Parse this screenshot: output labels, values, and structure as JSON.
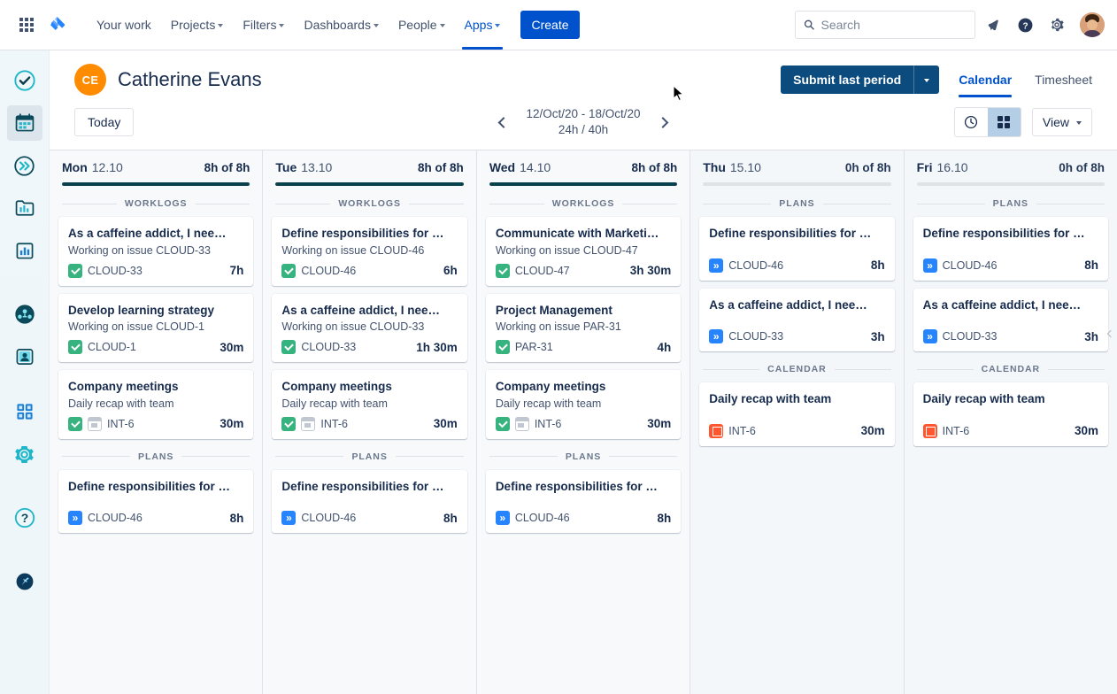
{
  "topnav": {
    "app_switcher_icon": "apps-grid-icon",
    "logo_icon": "jira-logo-icon",
    "items": [
      {
        "label": "Your work",
        "has_caret": false,
        "active": false
      },
      {
        "label": "Projects",
        "has_caret": true,
        "active": false
      },
      {
        "label": "Filters",
        "has_caret": true,
        "active": false
      },
      {
        "label": "Dashboards",
        "has_caret": true,
        "active": false
      },
      {
        "label": "People",
        "has_caret": true,
        "active": false
      },
      {
        "label": "Apps",
        "has_caret": true,
        "active": true
      }
    ],
    "create_label": "Create",
    "search": {
      "placeholder": "Search",
      "value": "",
      "icon": "search-icon"
    },
    "notifications_icon": "notifications-bell-icon",
    "help_icon": "help-circle-icon",
    "settings_icon": "gear-icon",
    "profile_icon": "profile-avatar"
  },
  "rail": {
    "items": [
      {
        "name": "tasks-check-icon",
        "selected": false
      },
      {
        "name": "calendar-icon",
        "selected": true
      },
      {
        "name": "epic-forward-icon",
        "selected": false
      },
      {
        "name": "reports-folder-icon",
        "selected": false
      },
      {
        "name": "analytics-chart-icon",
        "selected": false
      },
      {
        "name": "team-globe-icon",
        "selected": false
      },
      {
        "name": "person-card-icon",
        "selected": false
      },
      {
        "name": "apps-squares-icon",
        "selected": false
      },
      {
        "name": "settings-gear-icon",
        "selected": false
      },
      {
        "name": "help-question-icon",
        "selected": false
      },
      {
        "name": "pin-icon",
        "selected": false
      }
    ]
  },
  "header": {
    "avatar_initials": "CE",
    "avatar_color": "#ff8b00",
    "user_name": "Catherine Evans",
    "submit_label": "Submit last period",
    "submit_color": "#0c4b7e",
    "tabs": [
      {
        "label": "Calendar",
        "active": true
      },
      {
        "label": "Timesheet",
        "active": false
      }
    ]
  },
  "toolbar": {
    "today_label": "Today",
    "prev_icon": "chevron-left-icon",
    "next_icon": "chevron-right-icon",
    "range_dates": "12/Oct/20 - 18/Oct/20",
    "range_hours": "24h / 40h",
    "timeline_view_icon": "clock-icon",
    "grid_view_icon": "grid-icon",
    "grid_view_active": true,
    "view_label": "View"
  },
  "section_labels": {
    "worklogs": "WORKLOGS",
    "plans": "PLANS",
    "calendar": "CALENDAR"
  },
  "days": [
    {
      "dow": "Mon",
      "date": "12.10",
      "hours": "8h of 8h",
      "progress_pct": 100,
      "sections": [
        {
          "label": "WORKLOGS",
          "cards": [
            {
              "kind": "worklog",
              "title": "As a caffeine addict, I nee…",
              "subtitle": "Working on issue CLOUD-33",
              "icons": [
                "task"
              ],
              "key": "CLOUD-33",
              "duration": "7h"
            },
            {
              "kind": "worklog",
              "title": "Develop learning strategy",
              "subtitle": "Working on issue CLOUD-1",
              "icons": [
                "task"
              ],
              "key": "CLOUD-1",
              "duration": "30m"
            },
            {
              "kind": "worklog",
              "title": "Company meetings",
              "subtitle": "Daily recap with team",
              "icons": [
                "task",
                "cal-grey"
              ],
              "key": "INT-6",
              "duration": "30m"
            }
          ]
        },
        {
          "label": "PLANS",
          "cards": [
            {
              "kind": "plan",
              "title": "Define responsibilities for …",
              "subtitle": "",
              "icons": [
                "epic"
              ],
              "key": "CLOUD-46",
              "duration": "8h"
            }
          ]
        }
      ]
    },
    {
      "dow": "Tue",
      "date": "13.10",
      "hours": "8h of 8h",
      "progress_pct": 100,
      "sections": [
        {
          "label": "WORKLOGS",
          "cards": [
            {
              "kind": "worklog",
              "title": "Define responsibilities for …",
              "subtitle": "Working on issue CLOUD-46",
              "icons": [
                "task"
              ],
              "key": "CLOUD-46",
              "duration": "6h"
            },
            {
              "kind": "worklog",
              "title": "As a caffeine addict, I nee…",
              "subtitle": "Working on issue CLOUD-33",
              "icons": [
                "task"
              ],
              "key": "CLOUD-33",
              "duration": "1h 30m"
            },
            {
              "kind": "worklog",
              "title": "Company meetings",
              "subtitle": "Daily recap with team",
              "icons": [
                "task",
                "cal-grey"
              ],
              "key": "INT-6",
              "duration": "30m"
            }
          ]
        },
        {
          "label": "PLANS",
          "cards": [
            {
              "kind": "plan",
              "title": "Define responsibilities for …",
              "subtitle": "",
              "icons": [
                "epic"
              ],
              "key": "CLOUD-46",
              "duration": "8h"
            }
          ]
        }
      ]
    },
    {
      "dow": "Wed",
      "date": "14.10",
      "hours": "8h of 8h",
      "progress_pct": 100,
      "sections": [
        {
          "label": "WORKLOGS",
          "cards": [
            {
              "kind": "worklog",
              "title": "Communicate with Marketi…",
              "subtitle": "Working on issue CLOUD-47",
              "icons": [
                "task"
              ],
              "key": "CLOUD-47",
              "duration": "3h 30m"
            },
            {
              "kind": "worklog",
              "title": "Project Management",
              "subtitle": "Working on issue PAR-31",
              "icons": [
                "task"
              ],
              "key": "PAR-31",
              "duration": "4h"
            },
            {
              "kind": "worklog",
              "title": "Company meetings",
              "subtitle": "Daily recap with team",
              "icons": [
                "task",
                "cal-grey"
              ],
              "key": "INT-6",
              "duration": "30m"
            }
          ]
        },
        {
          "label": "PLANS",
          "cards": [
            {
              "kind": "plan",
              "title": "Define responsibilities for …",
              "subtitle": "",
              "icons": [
                "epic"
              ],
              "key": "CLOUD-46",
              "duration": "8h"
            }
          ]
        }
      ]
    },
    {
      "dow": "Thu",
      "date": "15.10",
      "hours": "0h of 8h",
      "progress_pct": 0,
      "sections": [
        {
          "label": "PLANS",
          "cards": [
            {
              "kind": "plan",
              "title": "Define responsibilities for …",
              "subtitle": "",
              "icons": [
                "epic"
              ],
              "key": "CLOUD-46",
              "duration": "8h"
            },
            {
              "kind": "plan",
              "title": "As a caffeine addict, I nee…",
              "subtitle": "",
              "icons": [
                "epic"
              ],
              "key": "CLOUD-33",
              "duration": "3h"
            }
          ]
        },
        {
          "label": "CALENDAR",
          "cards": [
            {
              "kind": "cal",
              "title": "Daily recap with team",
              "subtitle": "",
              "icons": [
                "event"
              ],
              "key": "INT-6",
              "duration": "30m"
            }
          ]
        }
      ]
    },
    {
      "dow": "Fri",
      "date": "16.10",
      "hours": "0h of 8h",
      "progress_pct": 0,
      "sections": [
        {
          "label": "PLANS",
          "cards": [
            {
              "kind": "plan",
              "title": "Define responsibilities for …",
              "subtitle": "",
              "icons": [
                "epic"
              ],
              "key": "CLOUD-46",
              "duration": "8h"
            },
            {
              "kind": "plan",
              "title": "As a caffeine addict, I nee…",
              "subtitle": "",
              "icons": [
                "epic"
              ],
              "key": "CLOUD-33",
              "duration": "3h"
            }
          ]
        },
        {
          "label": "CALENDAR",
          "cards": [
            {
              "kind": "cal",
              "title": "Daily recap with team",
              "subtitle": "",
              "icons": [
                "event"
              ],
              "key": "INT-6",
              "duration": "30m"
            }
          ]
        }
      ]
    }
  ],
  "collapse_handle_icon": "chevron-left-icon"
}
